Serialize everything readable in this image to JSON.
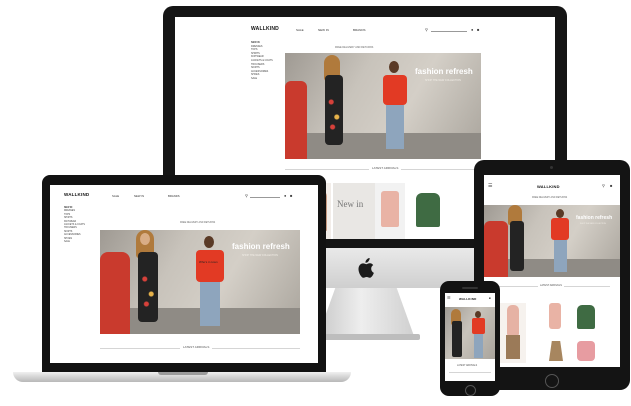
{
  "brand": "WALLKIND",
  "nav": [
    "SALE",
    "NEW IN",
    "BRANDS"
  ],
  "sidebar": [
    "NEW IN",
    "DRESSES",
    "TOPS",
    "SHIRTS",
    "KNITWEAR",
    "JACKETS & COATS",
    "TROUSERS",
    "SKIRTS",
    "ACCESSORIES",
    "SHOES",
    "SALE"
  ],
  "hero": {
    "title": "fashion refresh",
    "subtitle": "SHOP THE NEW COLLECTION",
    "shirt_text": "Who's in town"
  },
  "section_title": "LATEST ARRIVALS",
  "promo_bar": "FREE DELIVERY AND RETURNS",
  "new_in_label": "New in",
  "colors": {
    "accent_red": "#e23a24",
    "frame_black": "#151515",
    "wall_grey": "#bdb7af"
  }
}
